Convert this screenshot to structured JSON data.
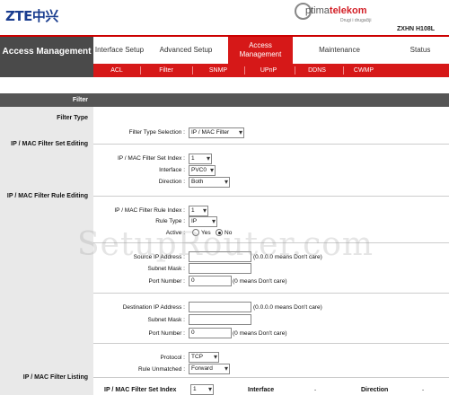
{
  "header": {
    "logo": "ZTE中兴",
    "brand_prefix": "ptima",
    "brand_suffix": "telekom",
    "brand_tagline": "Drugi i drugačiji",
    "model": "ZXHN H108L"
  },
  "nav": {
    "current_section": "Access Management",
    "tabs": [
      "Interface Setup",
      "Advanced Setup",
      "Access Management",
      "Maintenance",
      "Status"
    ],
    "subtabs": [
      "ACL",
      "Filter",
      "SNMP",
      "UPnP",
      "DDNS",
      "CWMP"
    ]
  },
  "page": {
    "header": "Filter",
    "sections": {
      "filter_type": "Filter Type",
      "set_editing": "IP / MAC Filter Set Editing",
      "rule_editing": "IP / MAC Filter Rule Editing",
      "listing": "IP / MAC Filter Listing"
    },
    "filter_type_label": "Filter Type Selection :",
    "filter_type_value": "IP / MAC Filter",
    "set_index_label": "IP / MAC Filter Set Index :",
    "set_index_value": "1",
    "interface_label": "Interface :",
    "interface_value": "PVC0",
    "direction_label": "Direction :",
    "direction_value": "Both",
    "rule_index_label": "IP / MAC Filter Rule Index :",
    "rule_index_value": "1",
    "rule_type_label": "Rule Type :",
    "rule_type_value": "IP",
    "active_label": "Active :",
    "active_yes": "Yes",
    "active_no": "No",
    "src_ip_label": "Source IP Address :",
    "src_ip_value": "",
    "src_ip_note": "(0.0.0.0 means Don't care)",
    "src_mask_label": "Subnet Mask :",
    "src_mask_value": "",
    "src_port_label": "Port Number :",
    "src_port_value": "0",
    "src_port_note": "(0 means Don't care)",
    "dst_ip_label": "Destination IP Address :",
    "dst_ip_value": "",
    "dst_ip_note": "(0.0.0.0 means Don't care)",
    "dst_mask_label": "Subnet Mask :",
    "dst_mask_value": "",
    "dst_port_label": "Port Number :",
    "dst_port_value": "0",
    "dst_port_note": "(0 means Don't care)",
    "protocol_label": "Protocol :",
    "protocol_value": "TCP",
    "unmatched_label": "Rule Unmatched :",
    "unmatched_value": "Forward",
    "list_set_index_label": "IP / MAC Filter Set Index",
    "list_set_index_value": "1",
    "list_interface_label": "Interface",
    "list_interface_value": "-",
    "list_direction_label": "Direction",
    "list_direction_value": "-"
  },
  "watermark": "SetupRouter.com",
  "colors": {
    "accent": "#d61818",
    "nav_dark": "#4a4a4a",
    "left_panel": "#e9e9e9"
  }
}
